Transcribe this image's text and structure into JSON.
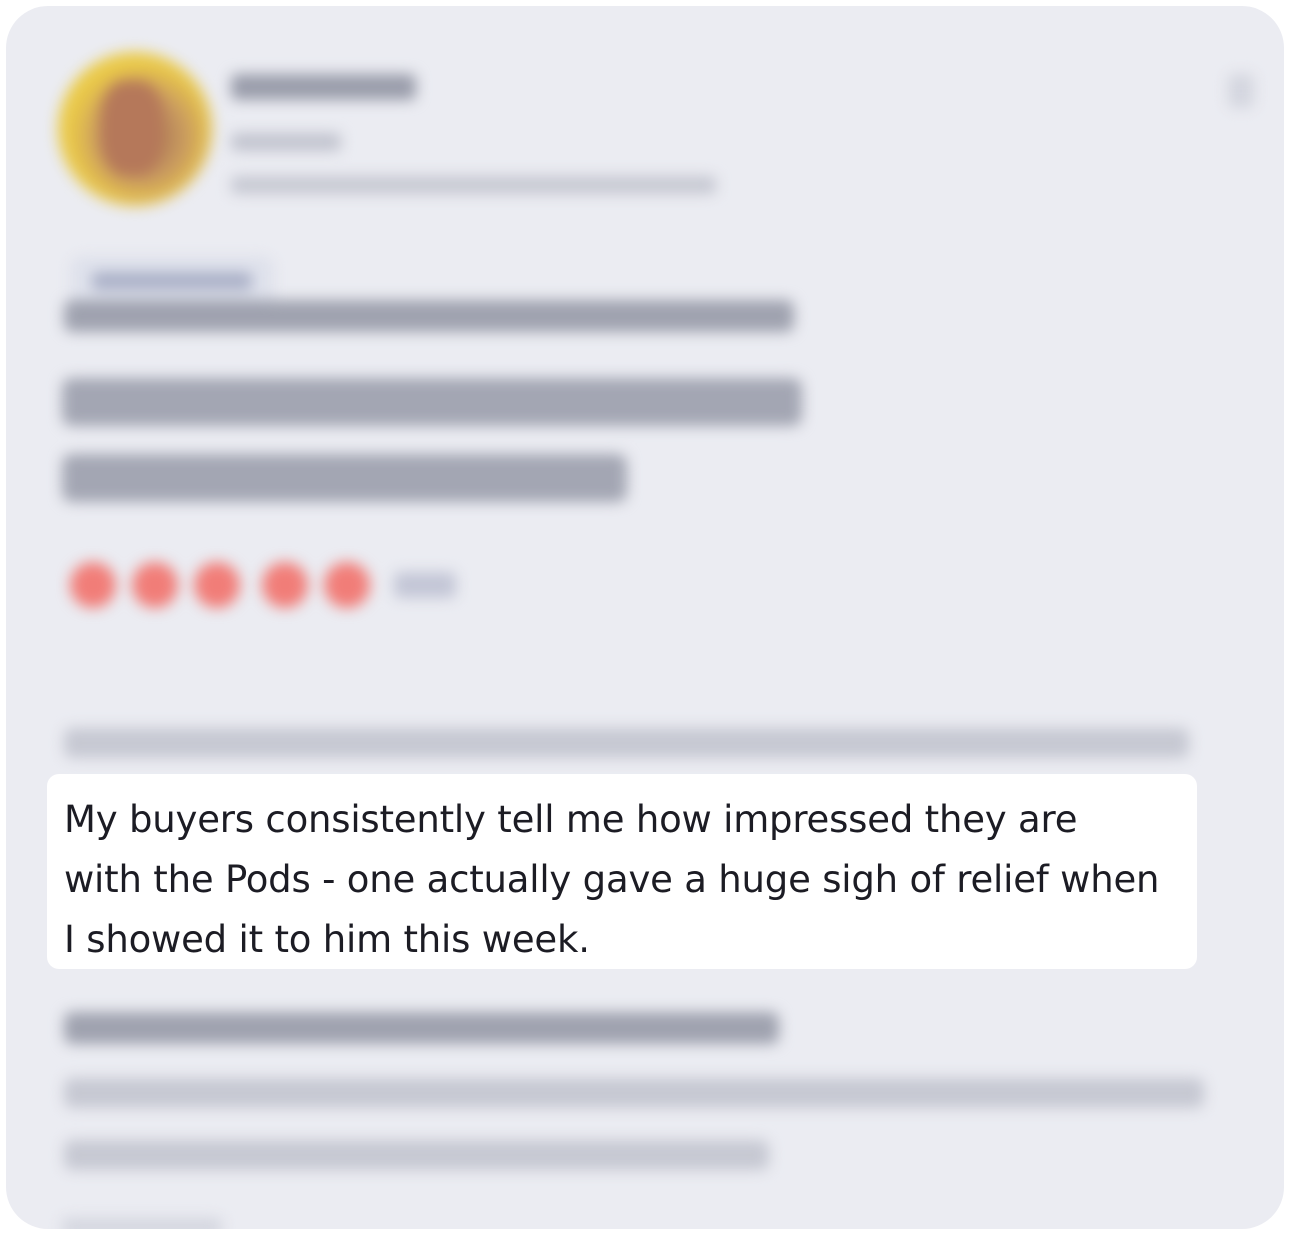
{
  "review": {
    "reviewer_avatar": "avatar",
    "rating_stars": 5,
    "star_color": "#f17d78",
    "highlighted_text_line1": "My buyers consistently tell me how impressed they are",
    "highlighted_text_line2": "with the Pods - one actually gave a huge sigh of relief when",
    "highlighted_text_line3": "I showed it to him this week."
  },
  "icons": {
    "menu": "more-vertical-icon",
    "star": "star-icon"
  }
}
